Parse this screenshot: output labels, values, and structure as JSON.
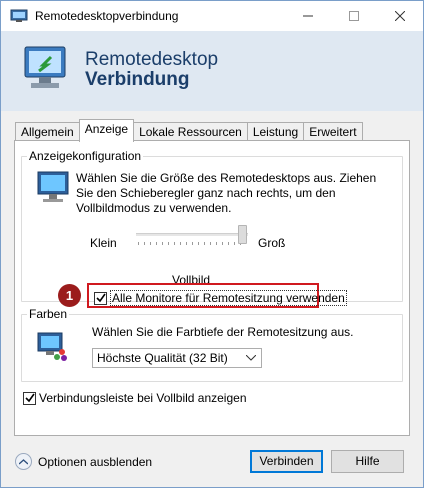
{
  "window": {
    "title": "Remotedesktopverbindung",
    "controls": {
      "minimize": "—",
      "maximize": "☐",
      "close": "✕"
    }
  },
  "banner": {
    "line1": "Remotedesktop",
    "line2": "Verbindung"
  },
  "tabs": [
    {
      "label": "Allgemein",
      "active": false
    },
    {
      "label": "Anzeige",
      "active": true
    },
    {
      "label": "Lokale Ressourcen",
      "active": false
    },
    {
      "label": "Leistung",
      "active": false
    },
    {
      "label": "Erweitert",
      "active": false
    }
  ],
  "display_group": {
    "title": "Anzeigekonfiguration",
    "description": "Wählen Sie die Größe des Remotedesktops aus. Ziehen Sie den Schieberegler ganz nach rechts, um den Vollbildmodus zu verwenden.",
    "slider_min_label": "Klein",
    "slider_max_label": "Groß",
    "slider_value_label": "Vollbild",
    "slider_level": 1.0,
    "multi_monitor_label": "Alle Monitore für Remotesitzung verwenden",
    "multi_monitor_checked": true,
    "callout_number": "1"
  },
  "colors_group": {
    "title": "Farben",
    "description": "Wählen Sie die Farbtiefe der Remotesitzung aus.",
    "color_depth_selected": "Höchste Qualität (32 Bit)"
  },
  "fullscreen_bar": {
    "label": "Verbindungsleiste bei Vollbild anzeigen",
    "checked": true
  },
  "footer": {
    "options_toggle": "Optionen ausblenden",
    "connect": "Verbinden",
    "help": "Hilfe"
  },
  "colors": {
    "accent": "#0078d7",
    "highlight": "#d0191f",
    "badge": "#9b1c1c",
    "banner": "#dfe8f2"
  }
}
